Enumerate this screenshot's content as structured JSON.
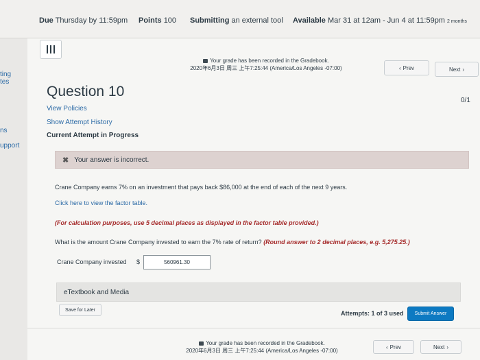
{
  "topbar": {
    "due_label": "Due",
    "due_value": "Thursday by 11:59pm",
    "points_label": "Points",
    "points_value": "100",
    "submitting_label": "Submitting",
    "submitting_value": "an external tool",
    "available_label": "Available",
    "available_value": "Mar 31 at 12am - Jun 4 at 11:59pm",
    "available_duration": "2 months"
  },
  "sidebar_fragments": [
    "ting",
    "tes",
    "ns",
    "upport"
  ],
  "gradebook_note": {
    "line1": "Your grade has been recorded in the Gradebook.",
    "line2": "2020年6月3日 周三 上午7:25:44 (America/Los Angeles -07:00)"
  },
  "nav": {
    "prev_label": "Prev",
    "next_label": "Next"
  },
  "question": {
    "title": "Question 10",
    "score": "0/1",
    "links": [
      "View Policies",
      "Show Attempt History"
    ],
    "attempt_status": "Current Attempt in Progress",
    "feedback": "Your answer is incorrect.",
    "prompt": "Crane Company earns 7% on an investment that pays back $86,000 at the end of each of the next 9 years.",
    "factor_link": "Click here to view the factor table.",
    "calc_note": "(For calculation purposes, use 5 decimal places as displayed in the factor table provided.)",
    "ask": "What is the amount Crane Company invested to earn the 7% rate of return?",
    "ask_note": "(Round answer to 2 decimal places, e.g. 5,275.25.)",
    "input_label": "Crane Company invested",
    "currency": "$",
    "input_value": "560961.30"
  },
  "etextbook_label": "eTextbook and Media",
  "footer": {
    "save_label": "Save for Later",
    "attempts": "Attempts: 1 of 3 used",
    "submit_label": "Submit Answer",
    "note_line1": "Your grade has been recorded in the Gradebook.",
    "note_line2": "2020年6月3日 周三 上午7:25:44 (America/Los Angeles -07:00)"
  }
}
